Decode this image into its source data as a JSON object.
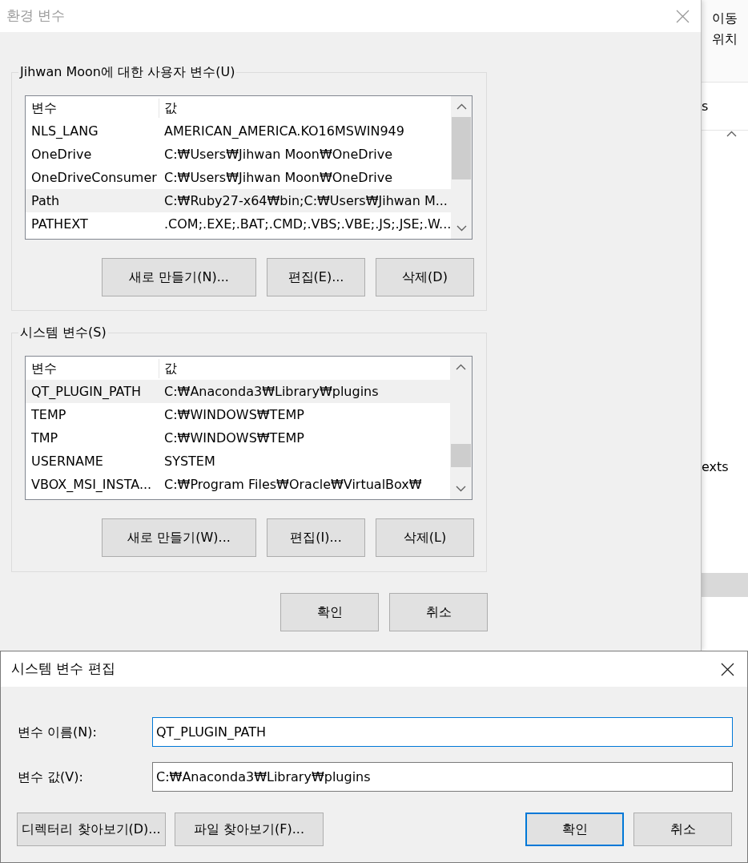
{
  "background_window": {
    "texts": [
      "이동",
      "위치",
      "s",
      "exts"
    ]
  },
  "env_window": {
    "title": "환경 변수",
    "groups": [
      {
        "label": "Jihwan Moon에 대한 사용자 변수(U)",
        "columns": [
          "변수",
          "값"
        ],
        "rows": [
          {
            "name": "NLS_LANG",
            "value": "AMERICAN_AMERICA.KO16MSWIN949",
            "selected": false
          },
          {
            "name": "OneDrive",
            "value": "C:₩Users₩Jihwan Moon₩OneDrive",
            "selected": false
          },
          {
            "name": "OneDriveConsumer",
            "value": "C:₩Users₩Jihwan Moon₩OneDrive",
            "selected": false
          },
          {
            "name": "Path",
            "value": "C:₩Ruby27-x64₩bin;C:₩Users₩Jihwan M...",
            "selected": true
          },
          {
            "name": "PATHEXT",
            "value": ".COM;.EXE;.BAT;.CMD;.VBS;.VBE;.JS;.JSE;.W...",
            "selected": false
          }
        ],
        "buttons": [
          "새로 만들기(N)...",
          "편집(E)...",
          "삭제(D)"
        ]
      },
      {
        "label": "시스템 변수(S)",
        "columns": [
          "변수",
          "값"
        ],
        "rows": [
          {
            "name": "QT_PLUGIN_PATH",
            "value": "C:₩Anaconda3₩Library₩plugins",
            "selected": true
          },
          {
            "name": "TEMP",
            "value": "C:₩WINDOWS₩TEMP",
            "selected": false
          },
          {
            "name": "TMP",
            "value": "C:₩WINDOWS₩TEMP",
            "selected": false
          },
          {
            "name": "USERNAME",
            "value": "SYSTEM",
            "selected": false
          },
          {
            "name": "VBOX_MSI_INSTA...",
            "value": "C:₩Program Files₩Oracle₩VirtualBox₩",
            "selected": false
          }
        ],
        "buttons": [
          "새로 만들기(W)...",
          "편집(I)...",
          "삭제(L)"
        ]
      }
    ],
    "buttons": [
      "확인",
      "취소"
    ]
  },
  "edit_dialog": {
    "title": "시스템 변수 편집",
    "fields": [
      {
        "label": "변수 이름(N):",
        "value": "QT_PLUGIN_PATH",
        "focused": true
      },
      {
        "label": "변수 값(V):",
        "value": "C:₩Anaconda3₩Library₩plugins",
        "focused": false
      }
    ],
    "buttons": [
      {
        "label": "디렉터리 찾아보기(D)...",
        "default": false
      },
      {
        "label": "파일 찾아보기(F)...",
        "default": false
      },
      {
        "label": "확인",
        "default": true
      },
      {
        "label": "취소",
        "default": false
      }
    ]
  }
}
